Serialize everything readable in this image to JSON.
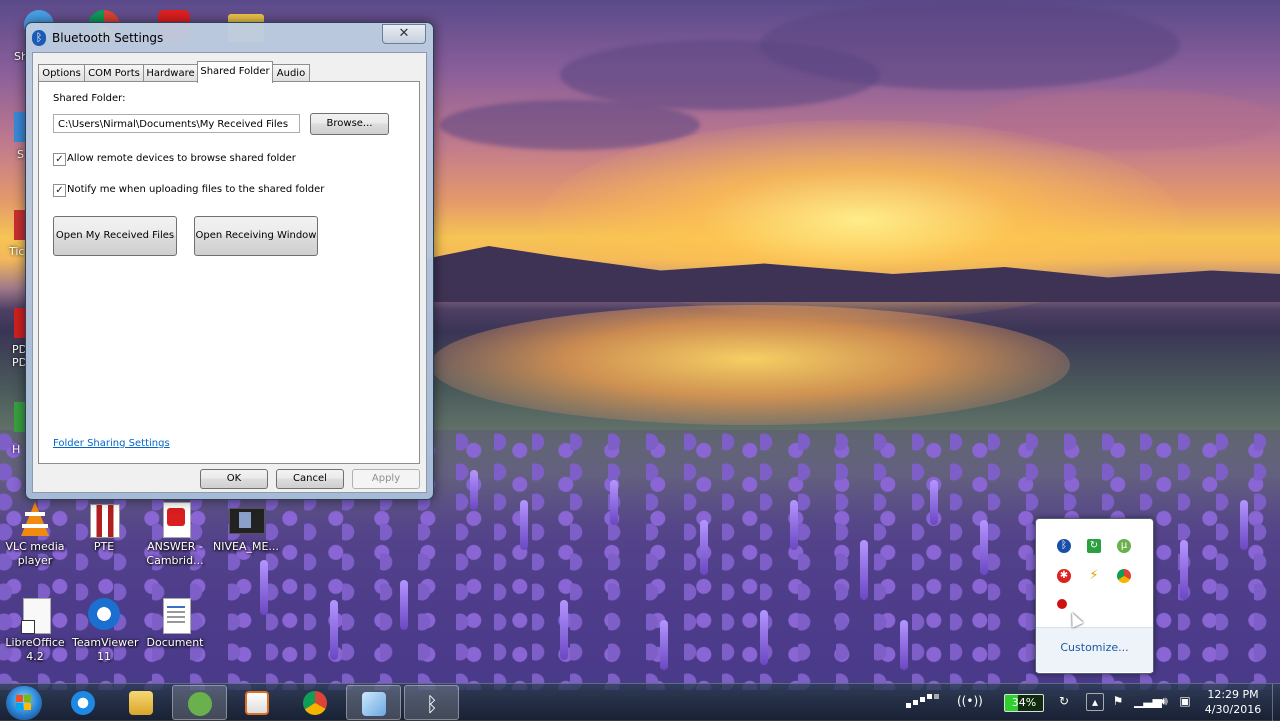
{
  "window": {
    "title": "Bluetooth Settings",
    "close_glyph": "✕",
    "tabs": [
      {
        "label": "Options",
        "active": false
      },
      {
        "label": "COM Ports",
        "active": false
      },
      {
        "label": "Hardware",
        "active": false
      },
      {
        "label": "Shared Folder",
        "active": true
      },
      {
        "label": "Audio",
        "active": false
      }
    ],
    "shared_folder_label": "Shared Folder:",
    "shared_folder_path": "C:\\Users\\Nirmal\\Documents\\My Received Files",
    "browse_label": "Browse...",
    "allow_remote_label": "Allow remote devices to browse shared folder",
    "allow_remote_checked": true,
    "notify_label": "Notify me when uploading files to the shared folder",
    "notify_checked": true,
    "open_received_label": "Open My Received Files",
    "open_receiving_window_label": "Open Receiving Window",
    "folder_sharing_link": "Folder Sharing Settings",
    "ok_label": "OK",
    "cancel_label": "Cancel",
    "apply_label": "Apply"
  },
  "desktop_icons": [
    {
      "label": "VLC media player",
      "icon": "vlc-icon"
    },
    {
      "label": "PTE",
      "icon": "pte-icon"
    },
    {
      "label": "ANSWER - Cambrid...",
      "icon": "pdf-icon"
    },
    {
      "label": "NIVEA_ME...",
      "icon": "video-icon"
    },
    {
      "label": "LibreOffice 4.2",
      "icon": "libreoffice-icon"
    },
    {
      "label": "TeamViewer 11",
      "icon": "teamviewer-icon"
    },
    {
      "label": "Document",
      "icon": "document-icon"
    }
  ],
  "clipped_labels": [
    "Sh",
    "S",
    "Tic",
    "PD",
    "PD",
    "H"
  ],
  "tray_flyout": {
    "customize_label": "Customize...",
    "icons": [
      "bluetooth-icon",
      "green-sync-icon",
      "utorrent-icon",
      "red-antivirus-icon",
      "flash-icon",
      "chrome-remote-icon",
      "red-dot-icon"
    ]
  },
  "taskbar": {
    "apps": [
      "internet-explorer-icon",
      "file-explorer-icon",
      "utorrent-icon",
      "media-player-icon",
      "chrome-icon",
      "notepad-icon",
      "bluetooth-icon"
    ],
    "battery_text": "34%",
    "time": "12:29 PM",
    "date": "4/30/2016"
  }
}
